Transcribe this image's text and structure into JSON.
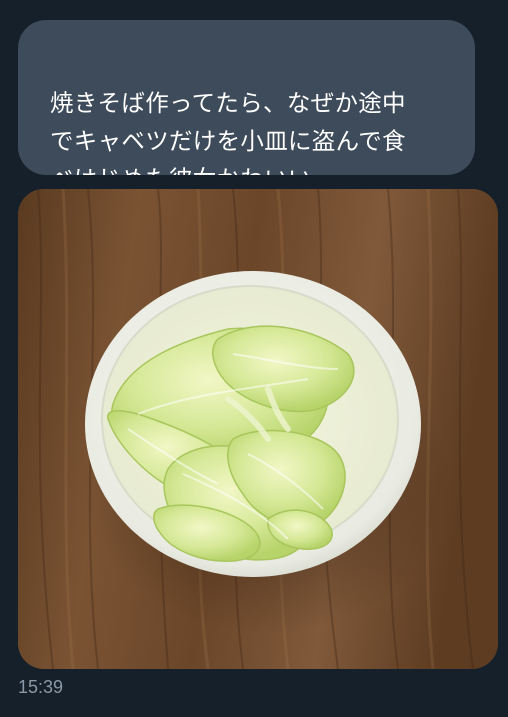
{
  "message": {
    "text": "焼きそば作ってたら、なぜか途中\nでキャベツだけを小皿に盗んで食\nべはじめた彼女かわいい",
    "time": "15:39",
    "bubble_color": "#3d4b5a",
    "text_color": "#ffffff"
  },
  "photo": {
    "subject": "stir-fried cabbage in small white bowl on wooden table"
  },
  "colors": {
    "background": "#15202b",
    "timestamp": "#8b98a5"
  }
}
